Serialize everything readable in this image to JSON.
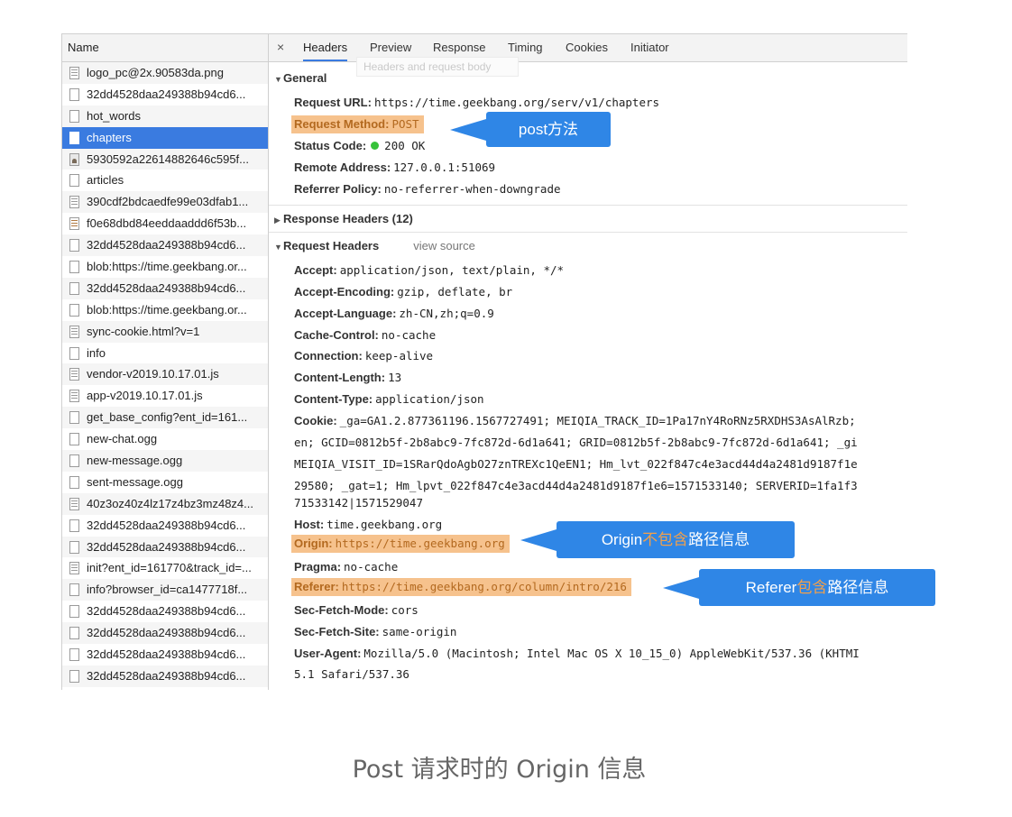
{
  "request_list": {
    "header": "Name",
    "rows": [
      {
        "name": "logo_pc@2x.90583da.png",
        "icon": "lines"
      },
      {
        "name": "32dd4528daa249388b94cd6...",
        "icon": "plain"
      },
      {
        "name": "hot_words",
        "icon": "plain"
      },
      {
        "name": "chapters",
        "icon": "plain",
        "selected": true
      },
      {
        "name": "5930592a22614882646c595f...",
        "icon": "img"
      },
      {
        "name": "articles",
        "icon": "plain"
      },
      {
        "name": "390cdf2bdcaedfe99e03dfab1...",
        "icon": "lines"
      },
      {
        "name": "f0e68dbd84eeddaaddd6f53b...",
        "icon": "brown"
      },
      {
        "name": "32dd4528daa249388b94cd6...",
        "icon": "plain"
      },
      {
        "name": "blob:https://time.geekbang.or...",
        "icon": "plain"
      },
      {
        "name": "32dd4528daa249388b94cd6...",
        "icon": "plain"
      },
      {
        "name": "blob:https://time.geekbang.or...",
        "icon": "plain"
      },
      {
        "name": "sync-cookie.html?v=1",
        "icon": "lines"
      },
      {
        "name": "info",
        "icon": "plain"
      },
      {
        "name": "vendor-v2019.10.17.01.js",
        "icon": "lines"
      },
      {
        "name": "app-v2019.10.17.01.js",
        "icon": "lines"
      },
      {
        "name": "get_base_config?ent_id=161...",
        "icon": "plain"
      },
      {
        "name": "new-chat.ogg",
        "icon": "plain"
      },
      {
        "name": "new-message.ogg",
        "icon": "plain"
      },
      {
        "name": "sent-message.ogg",
        "icon": "plain"
      },
      {
        "name": "40z3oz40z4lz17z4bz3mz48z4...",
        "icon": "lines"
      },
      {
        "name": "32dd4528daa249388b94cd6...",
        "icon": "plain"
      },
      {
        "name": "32dd4528daa249388b94cd6...",
        "icon": "plain"
      },
      {
        "name": "init?ent_id=161770&track_id=...",
        "icon": "lines"
      },
      {
        "name": "info?browser_id=ca1477718f...",
        "icon": "plain"
      },
      {
        "name": "32dd4528daa249388b94cd6...",
        "icon": "plain"
      },
      {
        "name": "32dd4528daa249388b94cd6...",
        "icon": "plain"
      },
      {
        "name": "32dd4528daa249388b94cd6...",
        "icon": "plain"
      },
      {
        "name": "32dd4528daa249388b94cd6...",
        "icon": "plain"
      }
    ]
  },
  "tabs": {
    "close": "×",
    "items": [
      "Headers",
      "Preview",
      "Response",
      "Timing",
      "Cookies",
      "Initiator"
    ],
    "tooltip": "Headers and request body"
  },
  "general": {
    "title": "General",
    "request_url": {
      "key": "Request URL:",
      "value": "https://time.geekbang.org/serv/v1/chapters"
    },
    "request_method": {
      "key": "Request Method:",
      "value": "POST"
    },
    "status_code": {
      "key": "Status Code:",
      "value": "200 OK"
    },
    "remote_address": {
      "key": "Remote Address:",
      "value": "127.0.0.1:51069"
    },
    "referrer_policy": {
      "key": "Referrer Policy:",
      "value": "no-referrer-when-downgrade"
    }
  },
  "response_headers": {
    "title": "Response Headers (12)"
  },
  "request_headers": {
    "title": "Request Headers",
    "view_source": "view source",
    "accept": {
      "key": "Accept:",
      "value": "application/json, text/plain, */*"
    },
    "accept_encoding": {
      "key": "Accept-Encoding:",
      "value": "gzip, deflate, br"
    },
    "accept_language": {
      "key": "Accept-Language:",
      "value": "zh-CN,zh;q=0.9"
    },
    "cache_control": {
      "key": "Cache-Control:",
      "value": "no-cache"
    },
    "connection": {
      "key": "Connection:",
      "value": "keep-alive"
    },
    "content_length": {
      "key": "Content-Length:",
      "value": "13"
    },
    "content_type": {
      "key": "Content-Type:",
      "value": "application/json"
    },
    "cookie": {
      "key": "Cookie:",
      "value": "_ga=GA1.2.877361196.1567727491; MEIQIA_TRACK_ID=1Pa17nY4RoRNz5RXDHS3AsAlRzb;",
      "lines": [
        "en; GCID=0812b5f-2b8abc9-7fc872d-6d1a641; GRID=0812b5f-2b8abc9-7fc872d-6d1a641; _gi",
        "MEIQIA_VISIT_ID=1SRarQdoAgbO27znTREXc1QeEN1; Hm_lvt_022f847c4e3acd44d4a2481d9187f1e",
        "29580; _gat=1; Hm_lpvt_022f847c4e3acd44d4a2481d9187f1e6=1571533140; SERVERID=1fa1f3",
        "71533142|1571529047"
      ]
    },
    "host": {
      "key": "Host:",
      "value": "time.geekbang.org"
    },
    "origin": {
      "key": "Origin:",
      "value": "https://time.geekbang.org"
    },
    "pragma": {
      "key": "Pragma:",
      "value": "no-cache"
    },
    "referer": {
      "key": "Referer:",
      "value": "https://time.geekbang.org/column/intro/216"
    },
    "sec_fetch_mode": {
      "key": "Sec-Fetch-Mode:",
      "value": "cors"
    },
    "sec_fetch_site": {
      "key": "Sec-Fetch-Site:",
      "value": "same-origin"
    },
    "user_agent": {
      "key": "User-Agent:",
      "value": "Mozilla/5.0 (Macintosh; Intel Mac OS X 10_15_0) AppleWebKit/537.36 (KHTMI",
      "line2": "5.1 Safari/537.36"
    }
  },
  "callouts": {
    "post": "post方法",
    "origin_a": "Origin",
    "origin_b": "不包含",
    "origin_c": "路径信息",
    "referer_a": "Referer",
    "referer_b": "包含",
    "referer_c": "路径信息",
    "color": "#2f86e6",
    "highlight_color": "#f6c28d"
  },
  "caption": "Post 请求时的 Origin 信息"
}
